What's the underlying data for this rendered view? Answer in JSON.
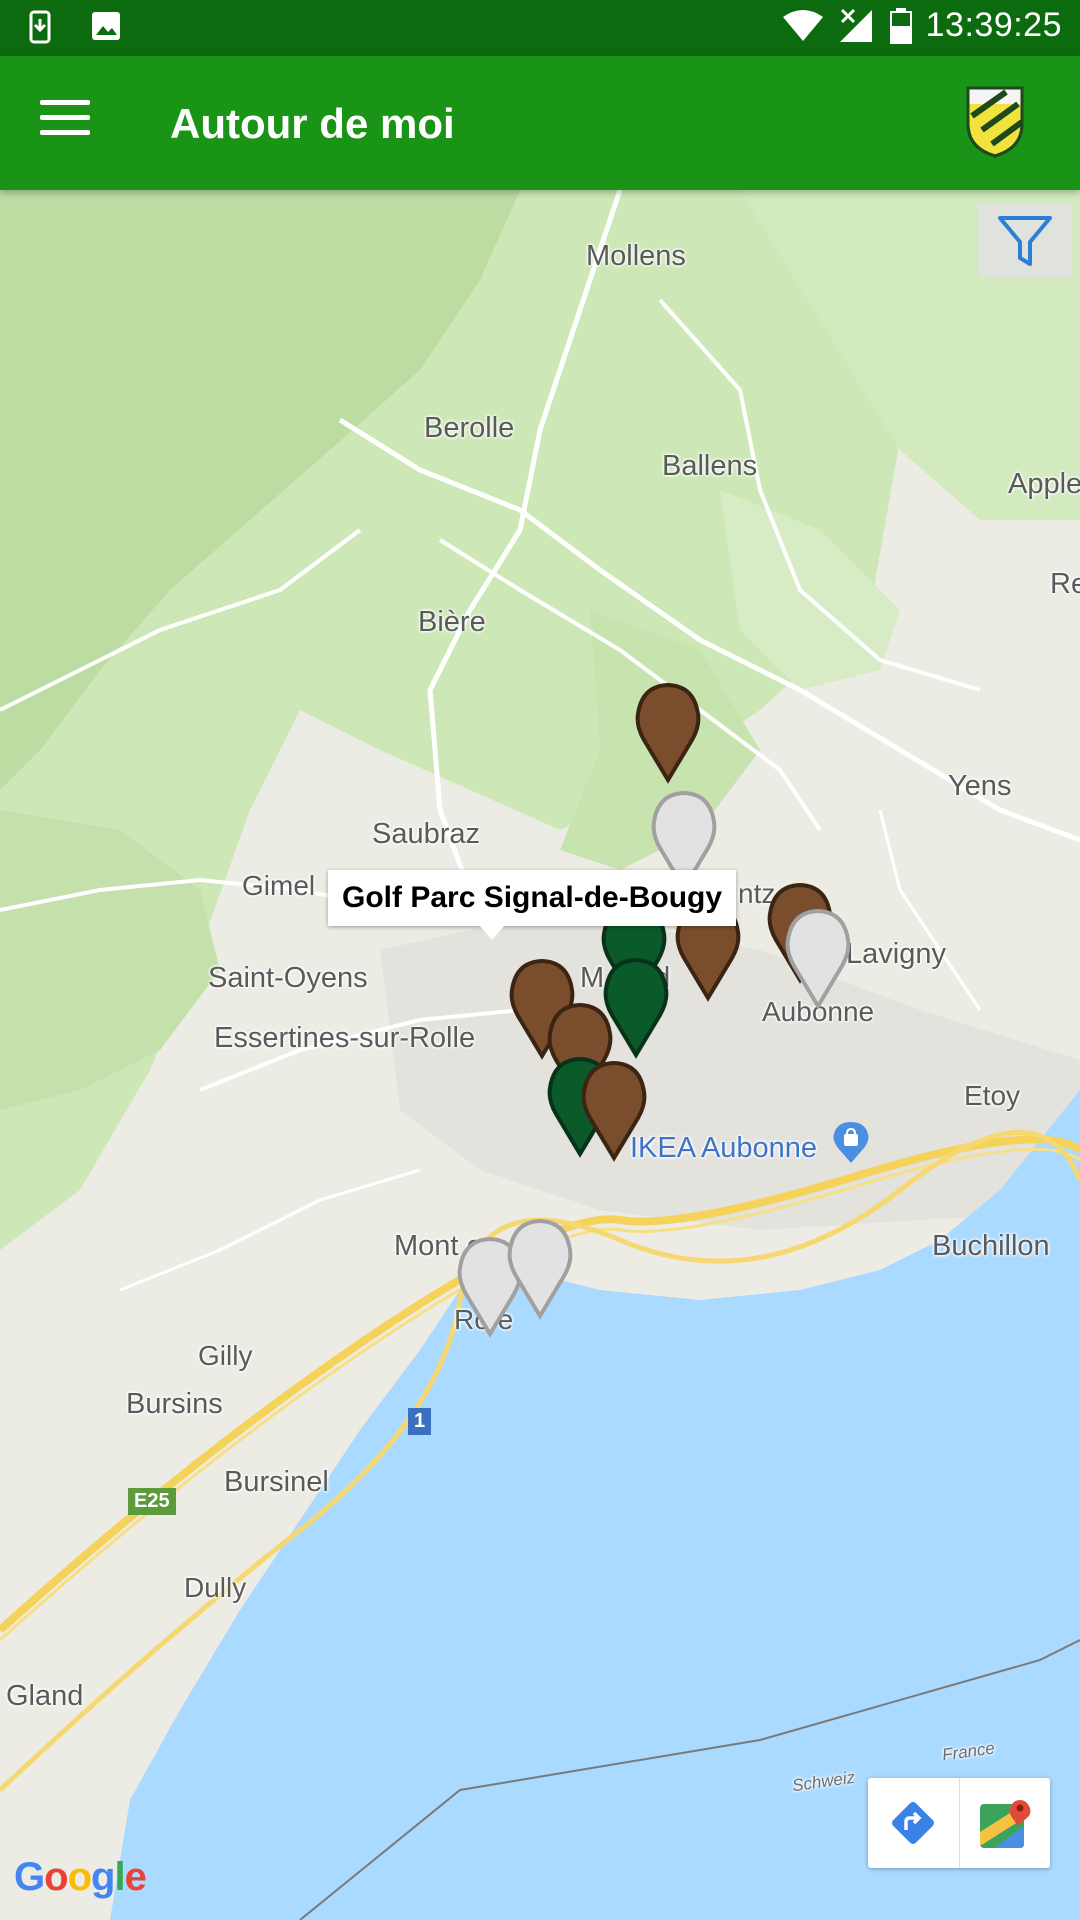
{
  "status_bar": {
    "time": "13:39:25",
    "icons": [
      "download-icon",
      "image-icon",
      "wifi-icon",
      "signal-icon",
      "battery-icon"
    ]
  },
  "app_bar": {
    "title": "Autour de moi",
    "menu_icon": "hamburger-icon",
    "logo": "vaud-crest-logo",
    "color": "#1a9416"
  },
  "map": {
    "places": [
      {
        "name": "Mollens"
      },
      {
        "name": "Berolle"
      },
      {
        "name": "Ballens"
      },
      {
        "name": "Apple"
      },
      {
        "name": "Re"
      },
      {
        "name": "Bière"
      },
      {
        "name": "Yens"
      },
      {
        "name": "Saubraz"
      },
      {
        "name": "Gimel"
      },
      {
        "name": "ntz    res"
      },
      {
        "name": "Lavigny"
      },
      {
        "name": "Saint-Oyens"
      },
      {
        "name": "M       erod"
      },
      {
        "name": "Aubonne"
      },
      {
        "name": "Essertines-sur-Rolle"
      },
      {
        "name": "Etoy"
      },
      {
        "name": "IKEA Aubonne"
      },
      {
        "name": "Mont          e"
      },
      {
        "name": "Buchillon"
      },
      {
        "name": "Ro   e"
      },
      {
        "name": "Gilly"
      },
      {
        "name": "Bursins"
      },
      {
        "name": "Bursinel"
      },
      {
        "name": "Dully"
      },
      {
        "name": "Gland"
      },
      {
        "name": "Schweiz"
      },
      {
        "name": "France"
      }
    ],
    "route_shields": [
      {
        "label": "1",
        "color": "#3b6fc2"
      },
      {
        "label": "E25",
        "color": "#5c9a3c"
      }
    ],
    "tooltip": "Golf Parc Signal-de-Bougy",
    "markers": [
      {
        "color": "brown"
      },
      {
        "color": "gray"
      },
      {
        "color": "green"
      },
      {
        "color": "brown"
      },
      {
        "color": "brown"
      },
      {
        "color": "brown"
      },
      {
        "color": "green"
      },
      {
        "color": "green"
      },
      {
        "color": "brown"
      },
      {
        "color": "brown"
      },
      {
        "color": "gray"
      },
      {
        "color": "gray"
      },
      {
        "color": "gray"
      }
    ],
    "marker_colors": {
      "brown": "#7a4e2d",
      "gray": "#e2e2e2",
      "green": "#0b5a2a"
    },
    "filter_icon": "filter-icon",
    "directions_icon": "directions-icon",
    "maps_icon": "google-maps-icon",
    "attribution": "Google"
  }
}
